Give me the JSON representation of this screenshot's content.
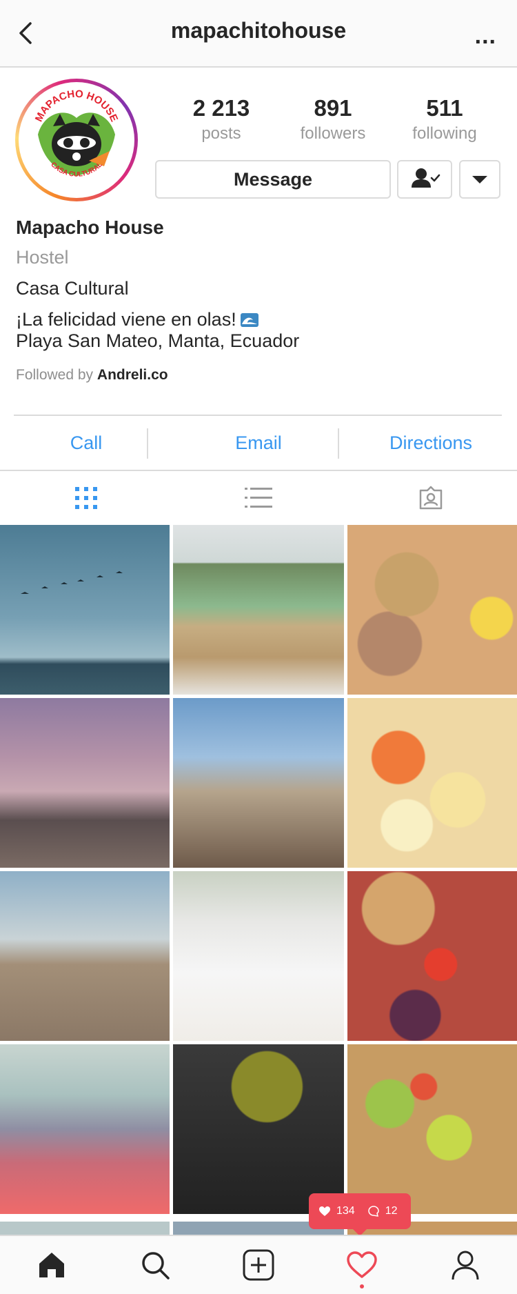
{
  "header": {
    "title": "mapachitohouse",
    "back_icon": "chevron-left-icon",
    "more_label": "..."
  },
  "profile": {
    "avatar_text_top": "MAPACHO HOUSE",
    "avatar_text_bottom": "CASA CULTURAL",
    "stats": [
      {
        "value": "2 213",
        "label": "posts"
      },
      {
        "value": "891",
        "label": "followers"
      },
      {
        "value": "511",
        "label": "following"
      }
    ],
    "message_label": "Message"
  },
  "bio": {
    "name": "Mapacho House",
    "category": "Hostel",
    "line1": "Casa Cultural",
    "line2": "¡La felicidad viene en olas!",
    "line3": "Playa San Mateo, Manta, Ecuador",
    "followed_by_prefix": "Followed by",
    "followed_by_user": "Andreli.co"
  },
  "actions": {
    "call": "Call",
    "email": "Email",
    "directions": "Directions"
  },
  "tabs": [
    "grid-icon",
    "list-icon",
    "tagged-icon"
  ],
  "activity": {
    "likes": "134",
    "comments": "12"
  },
  "colors": {
    "accent": "#3897f0",
    "notification": "#ed4956",
    "border": "#dbdbdb",
    "muted": "#999999"
  }
}
